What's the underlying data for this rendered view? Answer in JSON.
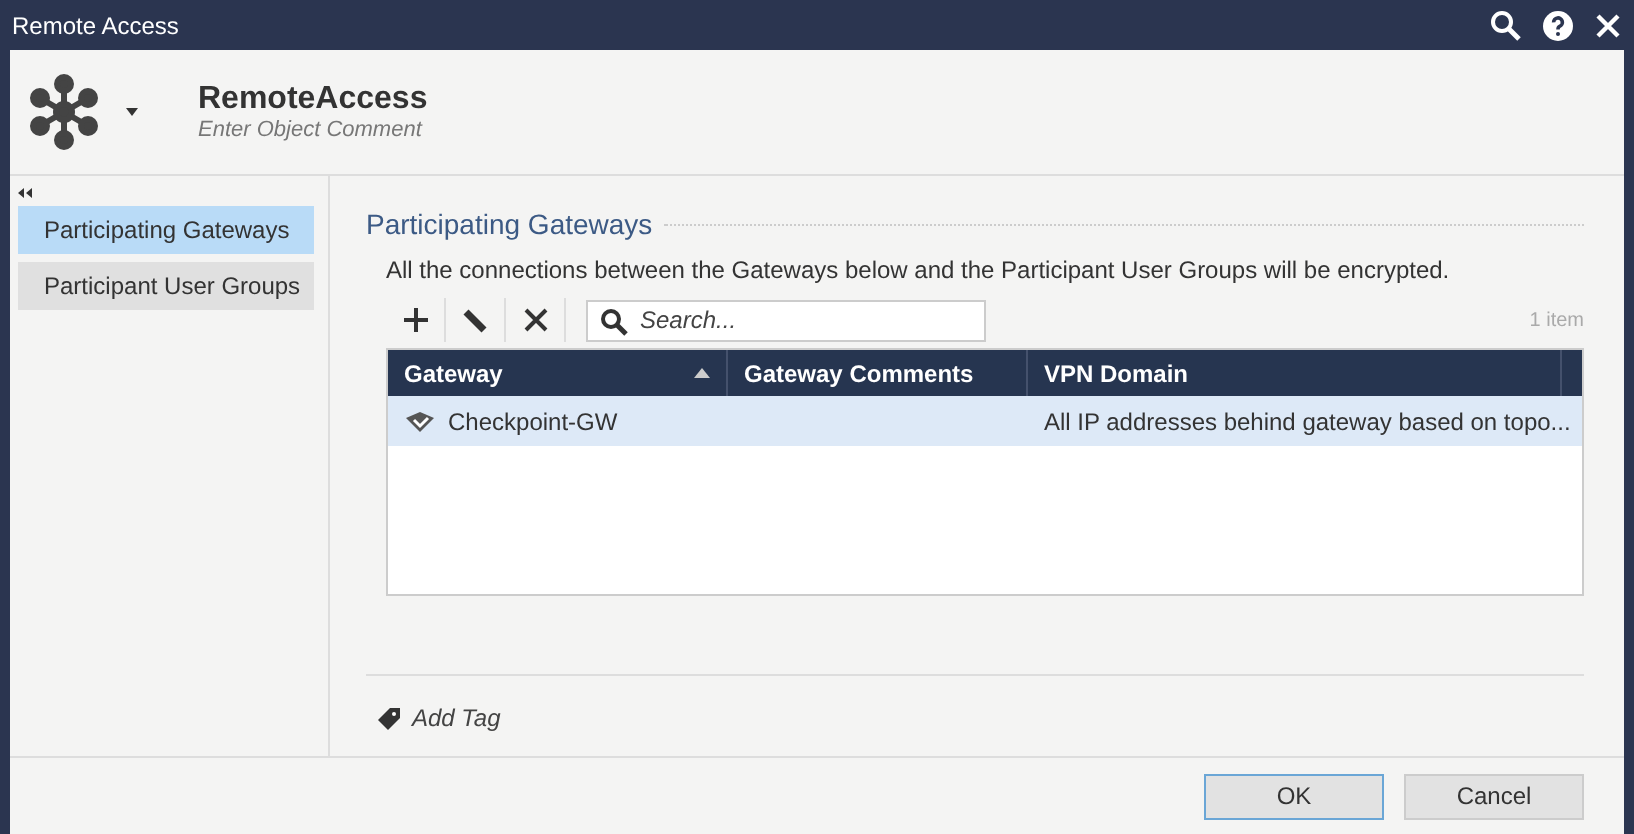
{
  "window": {
    "title": "Remote Access"
  },
  "header": {
    "name": "RemoteAccess",
    "comment_placeholder": "Enter Object Comment"
  },
  "sidebar": {
    "items": [
      {
        "label": "Participating Gateways",
        "selected": true
      },
      {
        "label": "Participant User Groups",
        "selected": false
      }
    ]
  },
  "section": {
    "title": "Participating Gateways",
    "description": "All the connections between the Gateways below and the Participant User Groups will be encrypted."
  },
  "toolbar": {
    "search_placeholder": "Search...",
    "count": "1 item"
  },
  "table": {
    "columns": [
      {
        "label": "Gateway",
        "sorted": true
      },
      {
        "label": "Gateway Comments",
        "sorted": false
      },
      {
        "label": "VPN Domain",
        "sorted": false
      }
    ],
    "rows": [
      {
        "cells": [
          "Checkpoint-GW",
          "",
          "All IP addresses behind gateway based on topo..."
        ],
        "selected": true
      }
    ]
  },
  "add_tag": "Add Tag",
  "buttons": [
    {
      "label": "OK",
      "kind": "primary"
    },
    {
      "label": "Cancel",
      "kind": "secondary"
    }
  ]
}
